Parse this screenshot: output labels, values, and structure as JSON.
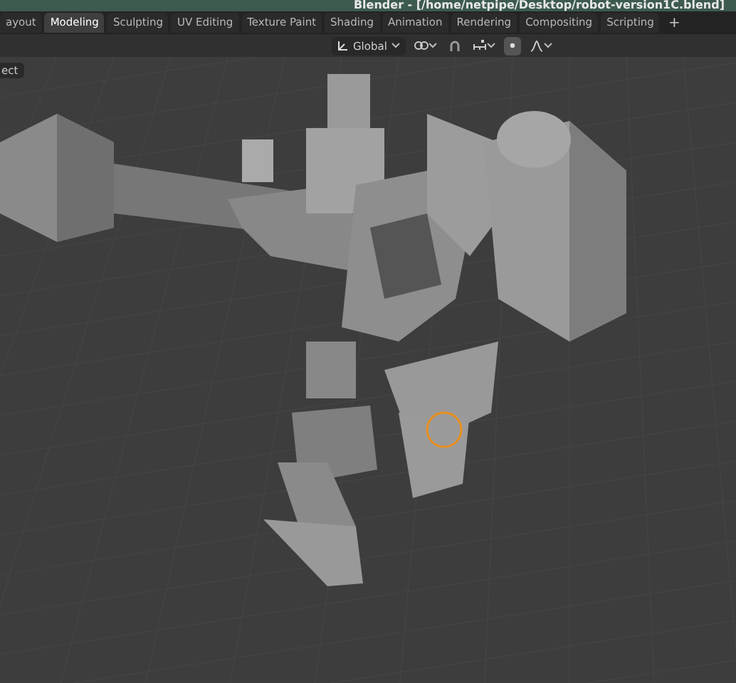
{
  "window": {
    "title": "Blender - [/home/netpipe/Desktop/robot-version1C.blend]"
  },
  "tabs": [
    {
      "label": "ayout",
      "selected": false
    },
    {
      "label": "Modeling",
      "selected": true
    },
    {
      "label": "Sculpting",
      "selected": false
    },
    {
      "label": "UV Editing",
      "selected": false
    },
    {
      "label": "Texture Paint",
      "selected": false
    },
    {
      "label": "Shading",
      "selected": false
    },
    {
      "label": "Animation",
      "selected": false
    },
    {
      "label": "Rendering",
      "selected": false
    },
    {
      "label": "Compositing",
      "selected": false
    },
    {
      "label": "Scripting",
      "selected": false
    }
  ],
  "add_tab": "+",
  "header": {
    "orientation": "Global"
  },
  "viewport": {
    "select_button": "ect"
  }
}
